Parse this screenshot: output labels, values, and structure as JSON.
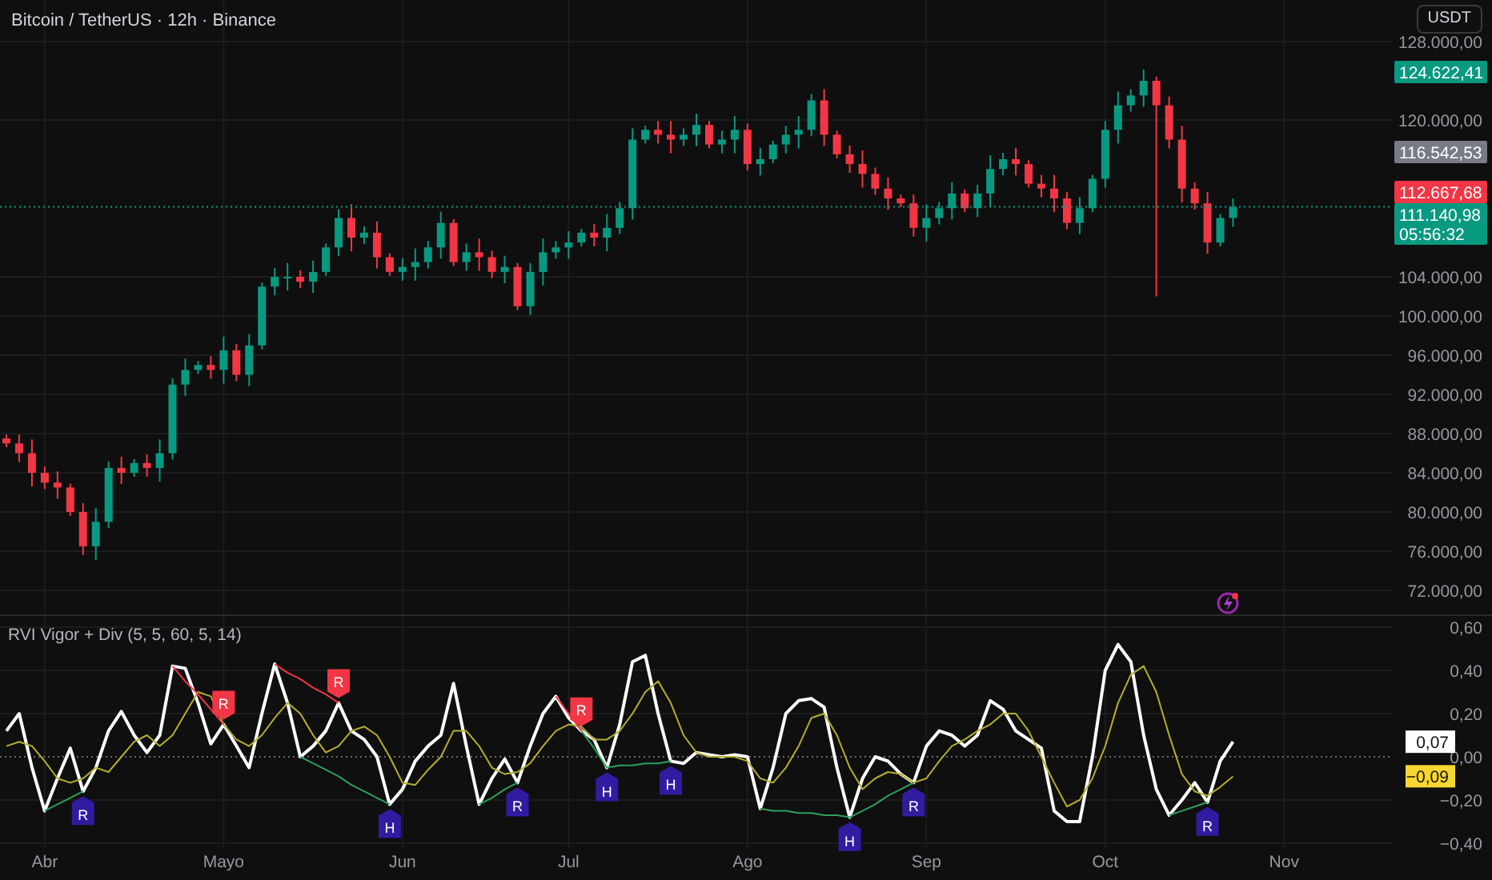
{
  "currency_button": "USDT",
  "price_chart": {
    "countdown": "05:56:32",
    "chart_data": {
      "type": "candlestick",
      "title": "Bitcoin / TetherUS · 12h · Binance",
      "grid": true,
      "ylim": [
        69388,
        132245
      ],
      "categories": [
        null,
        null,
        null,
        null,
        null,
        null,
        null,
        null,
        null,
        null,
        null,
        null,
        null,
        null,
        null,
        null,
        null,
        null,
        null,
        null,
        null,
        null,
        null,
        null,
        null,
        null,
        null,
        null,
        null,
        null,
        null,
        null,
        null,
        null,
        null,
        null,
        null,
        null,
        null,
        null,
        null,
        null,
        null,
        null,
        null,
        null,
        null,
        null,
        null,
        null,
        null,
        null,
        null,
        null,
        null,
        null,
        null,
        null,
        null,
        null,
        null,
        null,
        null,
        null,
        null,
        null,
        null,
        null,
        null,
        null,
        null,
        null,
        null,
        null,
        null,
        null,
        null,
        null,
        null,
        null,
        null,
        null,
        null,
        null,
        null,
        null,
        null,
        null,
        null,
        null,
        null,
        null,
        null,
        null,
        null,
        null,
        null,
        null,
        null,
        null,
        null,
        null,
        null,
        null,
        null,
        null,
        null,
        null,
        null
      ],
      "ohlc": [
        [
          87500,
          87900,
          86600,
          87000
        ],
        [
          87000,
          87900,
          85100,
          86000
        ],
        [
          86000,
          87400,
          82600,
          84000
        ],
        [
          84000,
          84650,
          82350,
          83000
        ],
        [
          83000,
          84150,
          81350,
          82500
        ],
        [
          82500,
          82900,
          79600,
          80000
        ],
        [
          80000,
          80900,
          75600,
          76500
        ],
        [
          76500,
          80400,
          75100,
          79000
        ],
        [
          79000,
          85150,
          78350,
          84500
        ],
        [
          84500,
          85650,
          82850,
          84000
        ],
        [
          84000,
          85400,
          83600,
          85000
        ],
        [
          85000,
          85900,
          83600,
          84500
        ],
        [
          84500,
          87400,
          83100,
          86000
        ],
        [
          86000,
          93650,
          85350,
          93000
        ],
        [
          93000,
          95650,
          91850,
          94500
        ],
        [
          94500,
          95400,
          94100,
          95000
        ],
        [
          95000,
          95900,
          93600,
          94500
        ],
        [
          94500,
          97900,
          93100,
          96500
        ],
        [
          96500,
          97150,
          93350,
          94000
        ],
        [
          94000,
          98150,
          92850,
          97000
        ],
        [
          97000,
          103400,
          96600,
          103000
        ],
        [
          103000,
          104900,
          102100,
          104000
        ],
        [
          104000,
          105400,
          102600,
          104000
        ],
        [
          104000,
          104650,
          102850,
          103500
        ],
        [
          103500,
          105650,
          102350,
          104500
        ],
        [
          104500,
          107400,
          104100,
          107000
        ],
        [
          107000,
          110900,
          106100,
          110000
        ],
        [
          110000,
          111400,
          106600,
          108000
        ],
        [
          108000,
          109150,
          107350,
          108500
        ],
        [
          108500,
          109650,
          104850,
          106000
        ],
        [
          106000,
          106400,
          104100,
          104500
        ],
        [
          104500,
          105900,
          103600,
          105000
        ],
        [
          105000,
          106900,
          103600,
          105500
        ],
        [
          105500,
          107650,
          104850,
          107000
        ],
        [
          107000,
          110650,
          105850,
          109500
        ],
        [
          109500,
          109900,
          105100,
          105500
        ],
        [
          105500,
          107400,
          104600,
          106500
        ],
        [
          106500,
          107900,
          104600,
          106000
        ],
        [
          106000,
          106650,
          103850,
          104500
        ],
        [
          104500,
          106150,
          103350,
          105000
        ],
        [
          105000,
          105400,
          100600,
          101000
        ],
        [
          101000,
          105400,
          100100,
          104500
        ],
        [
          104500,
          107900,
          103100,
          106500
        ],
        [
          106500,
          107650,
          105850,
          107000
        ],
        [
          107000,
          108650,
          105850,
          107500
        ],
        [
          107500,
          108900,
          107100,
          108500
        ],
        [
          108500,
          109400,
          107100,
          108000
        ],
        [
          108000,
          110400,
          106600,
          109000
        ],
        [
          109000,
          111650,
          108350,
          111000
        ],
        [
          111000,
          119150,
          109850,
          118000
        ],
        [
          118000,
          119400,
          117600,
          119000
        ],
        [
          119000,
          119900,
          117600,
          118500
        ],
        [
          118500,
          119900,
          116600,
          118000
        ],
        [
          118000,
          119150,
          117350,
          118500
        ],
        [
          118500,
          120650,
          117350,
          119500
        ],
        [
          119500,
          119900,
          117100,
          117500
        ],
        [
          117500,
          118900,
          116600,
          118000
        ],
        [
          118000,
          120400,
          116600,
          119000
        ],
        [
          119000,
          119650,
          114850,
          115500
        ],
        [
          115500,
          117150,
          114350,
          116000
        ],
        [
          116000,
          117900,
          115600,
          117500
        ],
        [
          117500,
          119400,
          116600,
          118500
        ],
        [
          118500,
          120400,
          117100,
          119000
        ],
        [
          119000,
          122650,
          118350,
          122000
        ],
        [
          122000,
          123150,
          117350,
          118500
        ],
        [
          118500,
          118900,
          116100,
          116500
        ],
        [
          116500,
          117400,
          114600,
          115500
        ],
        [
          115500,
          116900,
          113100,
          114500
        ],
        [
          114500,
          115150,
          112350,
          113000
        ],
        [
          113000,
          114150,
          110850,
          112000
        ],
        [
          112000,
          112400,
          111100,
          111500
        ],
        [
          111500,
          112400,
          108100,
          109000
        ],
        [
          109000,
          111400,
          107600,
          110000
        ],
        [
          110000,
          111650,
          109350,
          111000
        ],
        [
          111000,
          113650,
          109850,
          112500
        ],
        [
          112500,
          112900,
          110600,
          111000
        ],
        [
          111000,
          113400,
          110100,
          112500
        ],
        [
          112500,
          116400,
          111100,
          115000
        ],
        [
          115000,
          116650,
          114350,
          116000
        ],
        [
          116000,
          117150,
          114350,
          115500
        ],
        [
          115500,
          115900,
          113100,
          113500
        ],
        [
          113500,
          114400,
          112100,
          113000
        ],
        [
          113000,
          114400,
          110600,
          112000
        ],
        [
          112000,
          112650,
          108850,
          109500
        ],
        [
          109500,
          112150,
          108350,
          111000
        ],
        [
          111000,
          114400,
          110600,
          114000
        ],
        [
          114000,
          119900,
          113100,
          119000
        ],
        [
          119000,
          122900,
          117600,
          121500
        ],
        [
          121500,
          123150,
          120850,
          122500
        ],
        [
          122500,
          125150,
          121350,
          124000
        ],
        [
          124000,
          124400,
          102000,
          121500
        ],
        [
          121500,
          122400,
          117100,
          118000
        ],
        [
          118000,
          119400,
          111600,
          113000
        ],
        [
          113000,
          113650,
          110850,
          111500
        ],
        [
          111500,
          112650,
          106350,
          107500
        ],
        [
          107500,
          110400,
          107100,
          110000
        ],
        [
          110000,
          112000,
          109100,
          111100
        ],
        null,
        null,
        null,
        null,
        null,
        null,
        null,
        null,
        null,
        null,
        null,
        null
      ],
      "yticks": [
        {
          "value": 128000,
          "label": "128.000,00"
        },
        {
          "value": 120000,
          "label": "120.000,00"
        },
        {
          "value": 104000,
          "label": "104.000,00"
        },
        {
          "value": 100000,
          "label": "100.000,00"
        },
        {
          "value": 96000,
          "label": "96.000,00"
        },
        {
          "value": 92000,
          "label": "92.000,00"
        },
        {
          "value": 88000,
          "label": "88.000,00"
        },
        {
          "value": 84000,
          "label": "84.000,00"
        },
        {
          "value": 80000,
          "label": "80.000,00"
        },
        {
          "value": 76000,
          "label": "76.000,00"
        },
        {
          "value": 72000,
          "label": "72.000,00"
        }
      ],
      "ref_lines": [
        {
          "axis": "y",
          "value": 111140.98,
          "color": "#089981",
          "line_style": "dotted"
        }
      ]
    },
    "price_tags": [
      {
        "text": "124.622,41",
        "color": "#089981"
      },
      {
        "text": "116.542,53",
        "color": "#787b86"
      },
      {
        "text": "112.667,68",
        "color": "#f23645"
      },
      {
        "text": "111.140,98",
        "color": "#089981"
      }
    ]
  },
  "indicator": {
    "legend": "RVI Vigor + Div (5, 5, 60, 5, 14)",
    "value_tags": [
      {
        "text": "0,07",
        "color": "#ffffff"
      },
      {
        "text": "−0,09",
        "color": "#f7d631"
      }
    ],
    "divergence_labels": [
      "R",
      "R",
      "R",
      "H",
      "R",
      "R",
      "H",
      "H",
      "H",
      "R",
      "R"
    ],
    "chart_data": {
      "type": "line",
      "grid": true,
      "ylim": [
        -0.422,
        0.652
      ],
      "categories": [
        null,
        null,
        null,
        "Abr",
        null,
        null,
        null,
        null,
        null,
        null,
        null,
        null,
        null,
        null,
        null,
        null,
        null,
        "Mayo",
        null,
        null,
        null,
        null,
        null,
        null,
        null,
        null,
        null,
        null,
        null,
        null,
        null,
        "Jun",
        null,
        null,
        null,
        null,
        null,
        null,
        null,
        null,
        null,
        null,
        null,
        null,
        "Jul",
        null,
        null,
        null,
        null,
        null,
        null,
        null,
        null,
        null,
        null,
        null,
        null,
        null,
        "Ago",
        null,
        null,
        null,
        null,
        null,
        null,
        null,
        null,
        null,
        null,
        null,
        null,
        null,
        "Sep",
        null,
        null,
        null,
        null,
        null,
        null,
        null,
        null,
        null,
        null,
        null,
        null,
        null,
        "Oct",
        null,
        null,
        null,
        null,
        null,
        null,
        null,
        null,
        null,
        null,
        null,
        null,
        null,
        "Nov",
        null,
        null,
        null,
        null,
        null,
        null,
        null,
        null
      ],
      "yticks": [
        {
          "value": 0.6,
          "label": "0,60"
        },
        {
          "value": 0.4,
          "label": "0,40"
        },
        {
          "value": 0.2,
          "label": "0,20"
        },
        {
          "value": 0,
          "label": "0,00"
        },
        {
          "value": -0.2,
          "label": "−0,20"
        },
        {
          "value": -0.4,
          "label": "−0,40"
        }
      ],
      "series": [
        {
          "color": "#ffffff",
          "values": [
            0.12,
            0.2,
            -0.05,
            -0.25,
            -0.1,
            0.04,
            -0.16,
            -0.05,
            0.12,
            0.21,
            0.1,
            0.02,
            0.1,
            0.42,
            0.41,
            0.25,
            0.06,
            0.15,
            0.05,
            -0.05,
            0.2,
            0.43,
            0.25,
            0.0,
            0.05,
            0.12,
            0.25,
            0.12,
            0.08,
            0.0,
            -0.22,
            -0.15,
            -0.02,
            0.05,
            0.1,
            0.34,
            0.05,
            -0.22,
            -0.1,
            -0.01,
            -0.12,
            0.05,
            0.2,
            0.28,
            0.18,
            0.12,
            0.08,
            -0.05,
            0.15,
            0.44,
            0.47,
            0.2,
            -0.02,
            -0.03,
            0.02,
            0.01,
            0.0,
            0.01,
            0.0,
            -0.24,
            -0.05,
            0.2,
            0.26,
            0.27,
            0.23,
            -0.05,
            -0.28,
            -0.1,
            0.0,
            -0.02,
            -0.08,
            -0.12,
            0.05,
            0.12,
            0.1,
            0.05,
            0.1,
            0.26,
            0.22,
            0.12,
            0.08,
            0.04,
            -0.25,
            -0.3,
            -0.3,
            0.0,
            0.4,
            0.52,
            0.44,
            0.1,
            -0.15,
            -0.27,
            -0.2,
            -0.12,
            -0.21,
            -0.02,
            0.07,
            null,
            null,
            null,
            null,
            null,
            null,
            null,
            null,
            null,
            null,
            null,
            null
          ]
        },
        {
          "color": "#b5ae2e",
          "values": [
            0.05,
            0.07,
            0.05,
            -0.02,
            -0.1,
            -0.12,
            -0.1,
            -0.05,
            -0.07,
            0.0,
            0.07,
            0.1,
            0.05,
            0.1,
            0.2,
            0.3,
            0.28,
            0.15,
            0.08,
            0.05,
            0.1,
            0.18,
            0.25,
            0.2,
            0.1,
            0.02,
            0.05,
            0.12,
            0.14,
            0.1,
            0.0,
            -0.12,
            -0.13,
            -0.06,
            0.0,
            0.12,
            0.12,
            0.05,
            -0.05,
            -0.08,
            -0.07,
            -0.03,
            0.05,
            0.12,
            0.15,
            0.14,
            0.08,
            0.08,
            0.12,
            0.2,
            0.3,
            0.35,
            0.25,
            0.1,
            0.02,
            0.0,
            0.0,
            0.0,
            -0.02,
            -0.1,
            -0.12,
            -0.05,
            0.05,
            0.18,
            0.2,
            0.1,
            -0.05,
            -0.15,
            -0.1,
            -0.07,
            -0.08,
            -0.12,
            -0.1,
            -0.02,
            0.05,
            0.08,
            0.12,
            0.15,
            0.2,
            0.2,
            0.12,
            0.0,
            -0.12,
            -0.23,
            -0.2,
            -0.1,
            0.05,
            0.25,
            0.38,
            0.42,
            0.3,
            0.1,
            -0.08,
            -0.16,
            -0.18,
            -0.14,
            -0.09,
            null,
            null,
            null,
            null,
            null,
            null,
            null,
            null,
            null,
            null,
            null,
            null
          ]
        },
        {
          "color": "#f23645",
          "values": [
            null,
            null,
            null,
            null,
            null,
            null,
            null,
            null,
            null,
            null,
            null,
            null,
            null,
            0.42,
            0.35,
            0.29,
            0.22,
            0.15,
            null,
            null,
            null,
            0.43,
            0.39,
            0.36,
            0.32,
            0.29,
            0.25,
            null,
            null,
            null,
            null,
            null,
            null,
            null,
            null,
            null,
            null,
            null,
            null,
            null,
            null,
            null,
            null,
            0.28,
            0.2,
            0.12,
            null,
            null,
            null,
            null,
            null,
            null,
            null,
            null,
            null,
            null,
            null,
            null,
            null,
            null,
            null,
            null,
            null,
            null,
            null,
            null,
            null,
            null,
            null,
            null,
            null,
            null,
            null,
            null,
            null,
            null,
            null,
            null,
            null,
            null,
            null,
            null,
            null,
            null,
            null,
            null,
            null,
            null,
            null,
            null,
            null,
            null,
            null,
            null,
            null,
            null,
            null,
            null,
            null,
            null,
            null,
            null,
            null,
            null,
            null,
            null,
            null,
            null,
            null
          ]
        },
        {
          "color": "#2e9e5c",
          "values": [
            null,
            null,
            null,
            -0.25,
            -0.22,
            -0.19,
            -0.16,
            null,
            null,
            null,
            null,
            null,
            null,
            null,
            null,
            null,
            null,
            null,
            null,
            null,
            null,
            null,
            null,
            0,
            -0.03,
            -0.06,
            -0.09,
            -0.13,
            -0.16,
            -0.19,
            -0.22,
            null,
            null,
            null,
            null,
            null,
            null,
            -0.22,
            -0.19,
            -0.15,
            -0.12,
            null,
            null,
            null,
            null,
            0.12,
            0.04,
            -0.05,
            -0.04,
            -0.04,
            -0.03,
            -0.03,
            -0.02,
            null,
            null,
            null,
            null,
            null,
            null,
            -0.24,
            -0.25,
            -0.25,
            -0.26,
            -0.26,
            -0.27,
            -0.27,
            -0.28,
            -0.25,
            -0.22,
            -0.18,
            -0.15,
            -0.12,
            null,
            null,
            null,
            null,
            null,
            null,
            null,
            null,
            null,
            null,
            null,
            null,
            null,
            null,
            null,
            null,
            null,
            null,
            null,
            -0.27,
            -0.25,
            -0.23,
            -0.21,
            null,
            null,
            null,
            null,
            null,
            null,
            null,
            null,
            null,
            null,
            null,
            null,
            null,
            null
          ]
        }
      ],
      "ref_lines": [
        {
          "axis": "y",
          "value": 0,
          "color": "#6a6a6a",
          "line_style": "dotted"
        }
      ]
    }
  }
}
